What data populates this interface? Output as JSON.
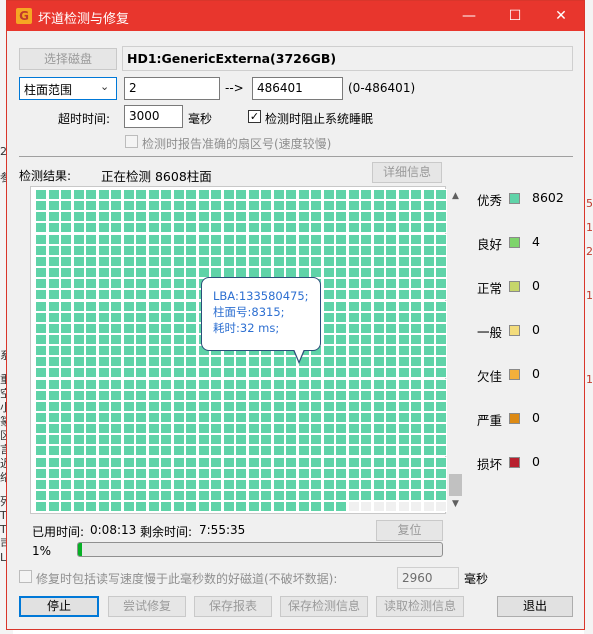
{
  "window": {
    "title": "坏道检测与修复",
    "app_icon": "G"
  },
  "titlebar_buttons": {
    "minimize": "—",
    "maximize": "☐",
    "close": "✕"
  },
  "disk": {
    "select_button": "选择磁盘",
    "name": "HD1:GenericExterna(3726GB)"
  },
  "range": {
    "mode": "柱面范围",
    "start": "2",
    "arrow": "-->",
    "end": "486401",
    "limits": "(0-486401)"
  },
  "timeout": {
    "label": "超时时间:",
    "value": "3000",
    "unit": "毫秒"
  },
  "options": {
    "prevent_sleep": "检测时阻止系统睡眠",
    "report_sector": "检测时报告准确的扇区号(速度较慢)"
  },
  "result": {
    "label": "检测结果:",
    "status": "正在检测 8608柱面",
    "detail_button": "详细信息"
  },
  "grid": {
    "columns": 33,
    "rows": 29,
    "tested_cells": 949
  },
  "tooltip": {
    "lba": "LBA:133580475;",
    "cylinder": "柱面号:8315;",
    "time": "耗时:32 ms;"
  },
  "legend": [
    {
      "label": "优秀",
      "count": "8602",
      "color": "#5fd3a8"
    },
    {
      "label": "良好",
      "count": "4",
      "color": "#7ed46b"
    },
    {
      "label": "正常",
      "count": "0",
      "color": "#c6d66a"
    },
    {
      "label": "一般",
      "count": "0",
      "color": "#f3dc7c"
    },
    {
      "label": "欠佳",
      "count": "0",
      "color": "#f4b03a"
    },
    {
      "label": "严重",
      "count": "0",
      "color": "#dd8a14"
    },
    {
      "label": "损坏",
      "count": "0",
      "color": "#b8202e"
    }
  ],
  "timing": {
    "elapsed_label": "已用时间:",
    "elapsed": "0:08:13",
    "remaining_label": "剩余时间:",
    "remaining": "7:55:35",
    "reset_button": "复位"
  },
  "progress": {
    "percent_text": "1%",
    "value": 0.01
  },
  "repair_option": {
    "label": "修复时包括读写速度慢于此毫秒数的好磁道(不破坏数据):",
    "value": "2960",
    "unit": "毫秒"
  },
  "actions": {
    "stop": "停止",
    "try_repair": "尝试修复",
    "save_report": "保存报表",
    "save_info": "保存检测信息",
    "read_info": "读取检测信息",
    "exit": "退出"
  },
  "background": {
    "left_chars": [
      "2",
      "参",
      "系",
      "重",
      "空",
      "小",
      "篆",
      "区",
      "言",
      "迟",
      "络",
      "列",
      "T",
      "T",
      "司",
      "L"
    ],
    "right_chars": [
      "5",
      "1",
      "2",
      "1",
      "1"
    ]
  }
}
